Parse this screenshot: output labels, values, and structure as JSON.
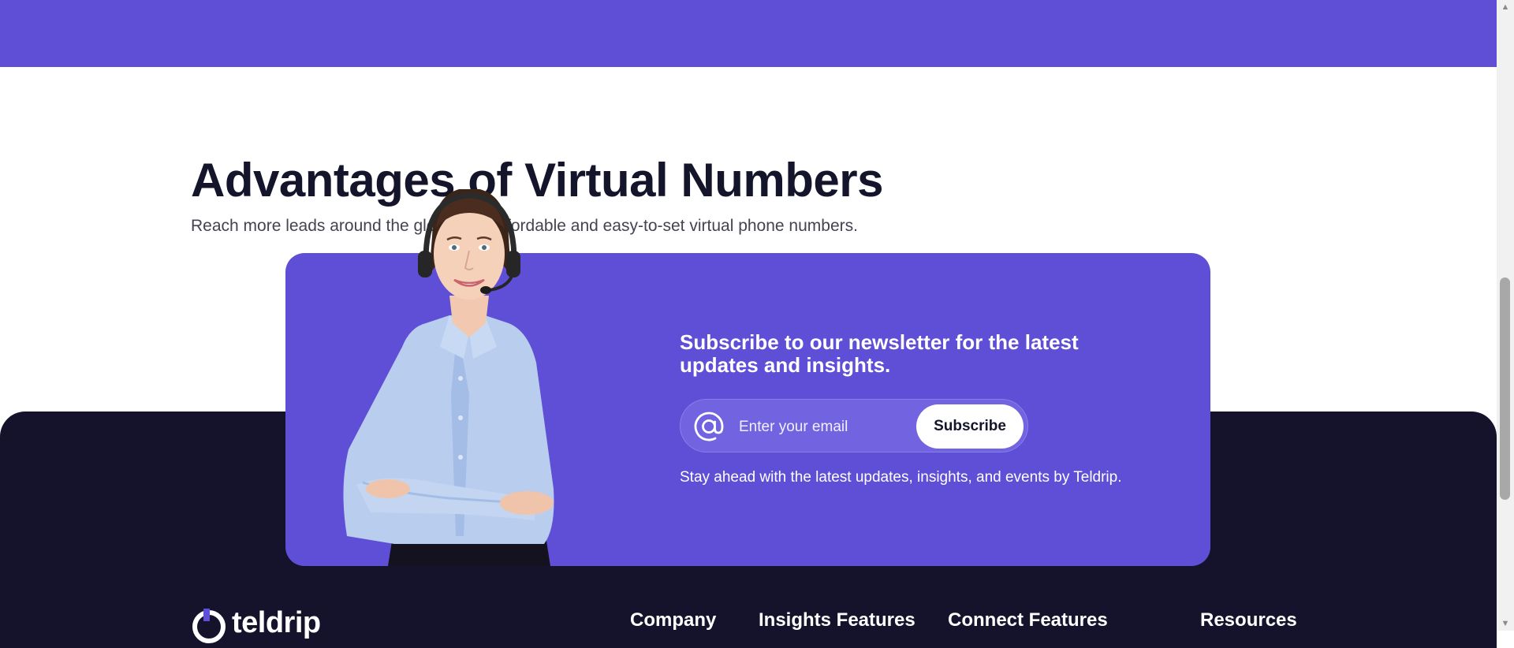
{
  "section": {
    "title": "Advantages of Virtual Numbers",
    "subtitle": "Reach more leads around the globe with affordable and easy-to-set virtual phone numbers."
  },
  "newsletter": {
    "heading": "Subscribe to our newsletter for the latest updates and insights.",
    "email_placeholder": "Enter your email",
    "subscribe_label": "Subscribe",
    "note": "Stay ahead with the latest updates, insights, and events by Teldrip.",
    "icon": "at-icon"
  },
  "footer": {
    "logo_text": "teldrip",
    "columns": [
      "Company",
      "Insights Features",
      "Connect Features",
      "Resources"
    ]
  },
  "colors": {
    "brand_purple": "#5f4fd6",
    "footer_dark": "#15122c"
  }
}
